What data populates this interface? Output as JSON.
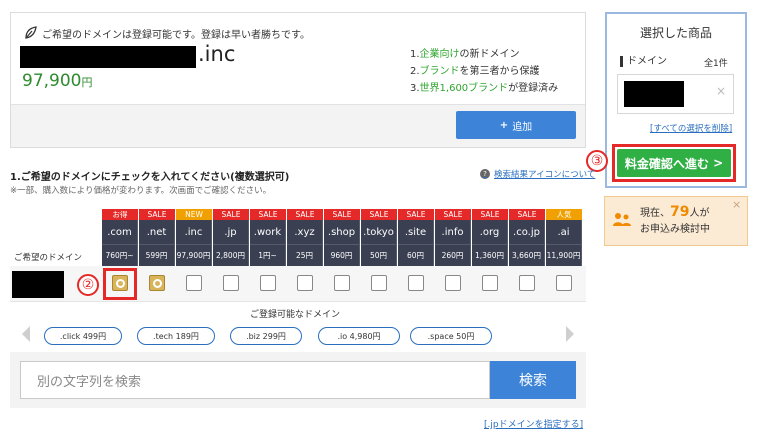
{
  "result": {
    "availability_message": "ご希望のドメインは登録可能です。登録は早い者勝ちです。",
    "domain_extension": ".inc",
    "price": "97,900",
    "price_unit": "円",
    "features": [
      {
        "num": "1.",
        "green": "企業向け",
        "rest": "の新ドメイン"
      },
      {
        "num": "2.",
        "green": "ブランド",
        "rest": "を第三者から保護"
      },
      {
        "num": "3.",
        "green": "世界1,600ブランド",
        "rest": "が登録済み"
      }
    ],
    "add_button": "追加",
    "add_icon": "+"
  },
  "selected": {
    "title": "選択した商品",
    "domain_label": "ドメイン",
    "count": "全1件",
    "remove_icon": "×",
    "clear_all": "[すべての選択を削除]",
    "checkout": "料金確認へ進む",
    "checkout_icon": ">"
  },
  "markers": {
    "two": "②",
    "three": "③"
  },
  "viewing": {
    "prefix": "現在、",
    "count": "79",
    "suffix": "人が",
    "line2": "お申込み検討中",
    "close": "×"
  },
  "instructions": {
    "title": "1.ご希望のドメインにチェックを入れてください(複数選択可)",
    "note": "※一部、購入数により価格が変わります。次画面でご確認ください。",
    "legend_link": "検索結果アイコンについて",
    "legend_icon": "?"
  },
  "table": {
    "row_label": "ご希望のドメイン",
    "tlds": [
      {
        "name": ".com",
        "price": "760円~",
        "badge": "お得",
        "badge_color": "#e52929",
        "checked": true
      },
      {
        "name": ".net",
        "price": "599円",
        "badge": "SALE",
        "badge_color": "#e52929",
        "checked": true
      },
      {
        "name": ".inc",
        "price": "97,900円",
        "badge": "NEW",
        "badge_color": "#f0a000",
        "checked": false
      },
      {
        "name": ".jp",
        "price": "2,800円",
        "badge": "SALE",
        "badge_color": "#e52929",
        "checked": false
      },
      {
        "name": ".work",
        "price": "1円~",
        "badge": "SALE",
        "badge_color": "#e52929",
        "checked": false
      },
      {
        "name": ".xyz",
        "price": "25円",
        "badge": "SALE",
        "badge_color": "#e52929",
        "checked": false
      },
      {
        "name": ".shop",
        "price": "960円",
        "badge": "SALE",
        "badge_color": "#e52929",
        "checked": false
      },
      {
        "name": ".tokyo",
        "price": "50円",
        "badge": "SALE",
        "badge_color": "#e52929",
        "checked": false
      },
      {
        "name": ".site",
        "price": "60円",
        "badge": "SALE",
        "badge_color": "#e52929",
        "checked": false
      },
      {
        "name": ".info",
        "price": "260円",
        "badge": "SALE",
        "badge_color": "#e52929",
        "checked": false
      },
      {
        "name": ".org",
        "price": "1,360円",
        "badge": "SALE",
        "badge_color": "#e52929",
        "checked": false
      },
      {
        "name": ".co.jp",
        "price": "3,660円",
        "badge": "SALE",
        "badge_color": "#e52929",
        "checked": false
      },
      {
        "name": ".ai",
        "price": "11,900円",
        "badge": "人気",
        "badge_color": "#f0a000",
        "checked": false
      }
    ]
  },
  "suggestions": {
    "title": "ご登録可能なドメイン",
    "items": [
      ".click 499円",
      ".tech 189円",
      ".biz 299円",
      ".io 4,980円",
      ".space 50円"
    ]
  },
  "search": {
    "placeholder": "別の文字列を検索",
    "button": "検索",
    "link": "[.jpドメインを指定する]"
  }
}
